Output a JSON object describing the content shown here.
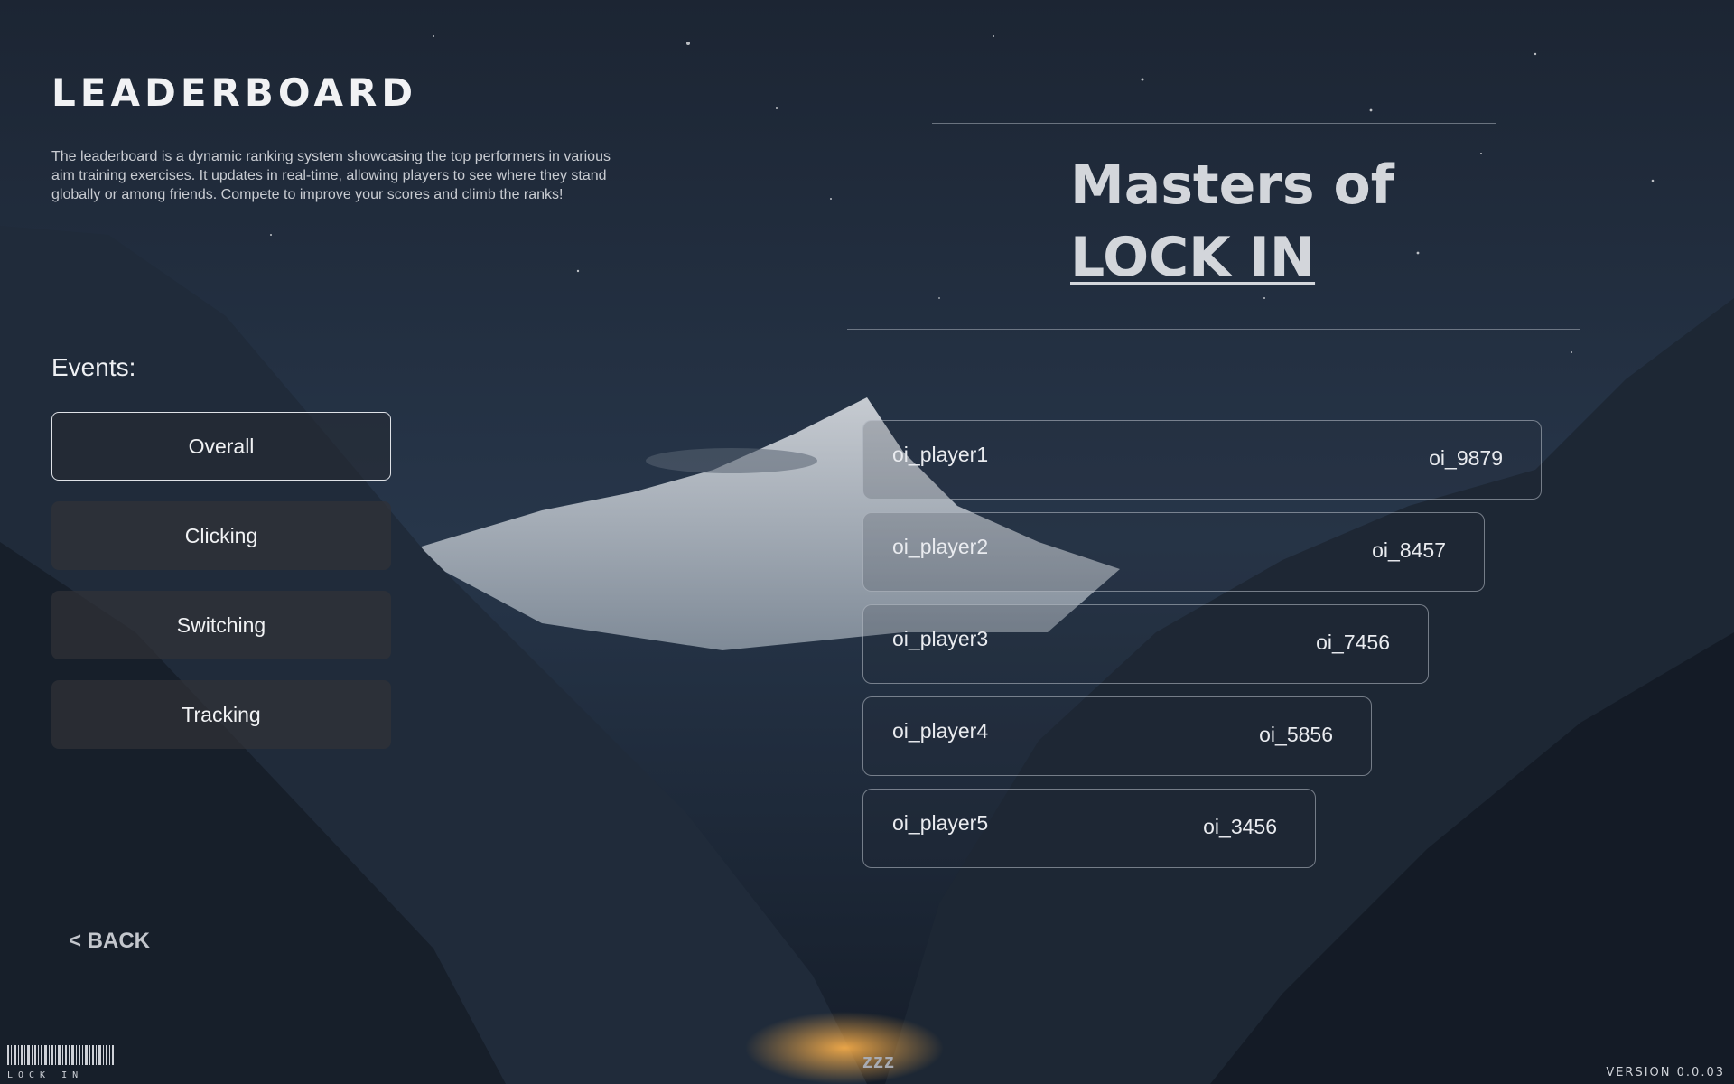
{
  "header": {
    "title": "LEADERBOARD",
    "description": "The leaderboard is a dynamic ranking system showcasing the top performers in various aim training exercises. It updates in real-time, allowing players to see where they stand globally or among friends. Compete to improve your scores and climb the ranks!"
  },
  "events": {
    "label": "Events:",
    "items": [
      {
        "label": "Overall",
        "active": true
      },
      {
        "label": "Clicking",
        "active": false
      },
      {
        "label": "Switching",
        "active": false
      },
      {
        "label": "Tracking",
        "active": false
      }
    ]
  },
  "hero": {
    "line1": "Masters of",
    "line2": "LOCK IN"
  },
  "leaderboard": {
    "rows": [
      {
        "name": "oi_player1",
        "score": "oi_9879"
      },
      {
        "name": "oi_player2",
        "score": "oi_8457"
      },
      {
        "name": "oi_player3",
        "score": "oi_7456"
      },
      {
        "name": "oi_player4",
        "score": "oi_5856"
      },
      {
        "name": "oi_player5",
        "score": "oi_3456"
      }
    ]
  },
  "footer": {
    "back_label": "< BACK",
    "brand_text": "LOCK IN",
    "status_text": "zzz",
    "version": "VERSION 0.0.03"
  },
  "colors": {
    "background": "#1a2331",
    "text": "#e6e8ec",
    "button_bg": "#30323a",
    "border": "#c4c9d1"
  },
  "icons": {
    "barcode": "barcode-logo-icon"
  }
}
